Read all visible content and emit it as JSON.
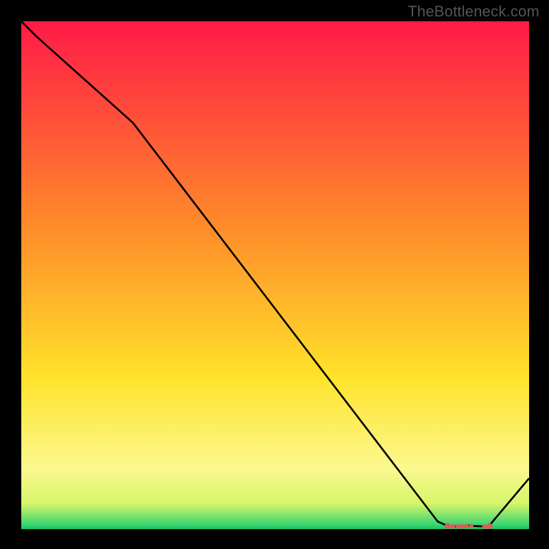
{
  "watermark": "TheBottleneck.com",
  "chart_data": {
    "type": "line",
    "title": "",
    "xlabel": "",
    "ylabel": "",
    "xlim": [
      0,
      100
    ],
    "ylim": [
      0,
      100
    ],
    "grid": false,
    "x": [
      0,
      3,
      22,
      82,
      84,
      86.5,
      88,
      89.5,
      92,
      100
    ],
    "values": [
      100,
      97,
      80,
      1.5,
      0.6,
      0.5,
      0.7,
      0.6,
      0.5,
      10
    ],
    "markers": {
      "x": [
        84,
        85,
        86,
        86.8,
        87.6,
        88.6,
        91.2,
        92.2
      ],
      "y": [
        0.6,
        0.55,
        0.52,
        0.55,
        0.6,
        0.58,
        0.52,
        0.55
      ]
    },
    "background_gradient_stops": [
      {
        "pct": 0,
        "color": "#ff1a47"
      },
      {
        "pct": 40,
        "color": "#ff8a2a"
      },
      {
        "pct": 70,
        "color": "#ffe22a"
      },
      {
        "pct": 88,
        "color": "#fbf88f"
      },
      {
        "pct": 95,
        "color": "#d6f56a"
      },
      {
        "pct": 99,
        "color": "#3fd66f"
      },
      {
        "pct": 100,
        "color": "#18c46a"
      }
    ]
  }
}
